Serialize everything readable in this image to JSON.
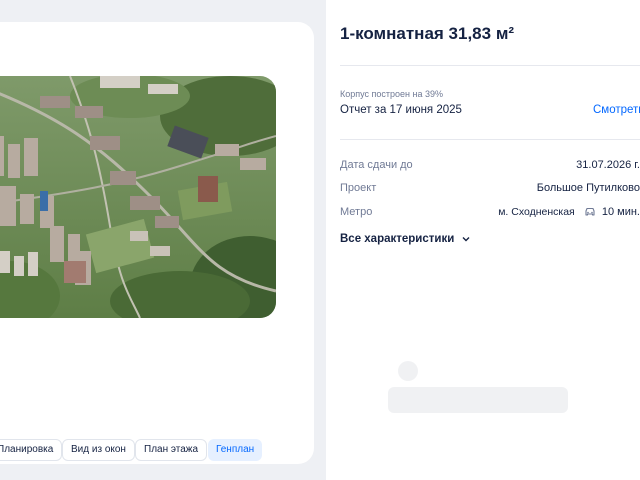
{
  "gallery": {
    "image_alt": "Аэрофотовизуализация жилого комплекса",
    "tabs": [
      {
        "label": "Планировка",
        "active": false
      },
      {
        "label": "Вид из окон",
        "active": false
      },
      {
        "label": "План этажа",
        "active": false
      },
      {
        "label": "Генплан",
        "active": true
      }
    ]
  },
  "listing": {
    "title": "1-комнатная 31,83 м²",
    "construction": {
      "built_label": "Корпус построен на 39%",
      "report_label": "Отчет за 17 июня 2025",
      "link_label": "Смотреть"
    },
    "characteristics": [
      {
        "key": "Дата сдачи до",
        "value": "31.07.2026 г."
      },
      {
        "key": "Проект",
        "value": "Большое Путилково"
      },
      {
        "key": "Метро",
        "value": "м. Сходненская",
        "transport_icon": "car-icon",
        "time": "10 мин."
      }
    ],
    "all_characteristics_label": "Все характеристики"
  },
  "colors": {
    "accent": "#0468ff",
    "text": "#152242",
    "muted": "#707a95",
    "page_bg": "#eef0f4",
    "active_tab_bg": "#e6f0ff"
  }
}
